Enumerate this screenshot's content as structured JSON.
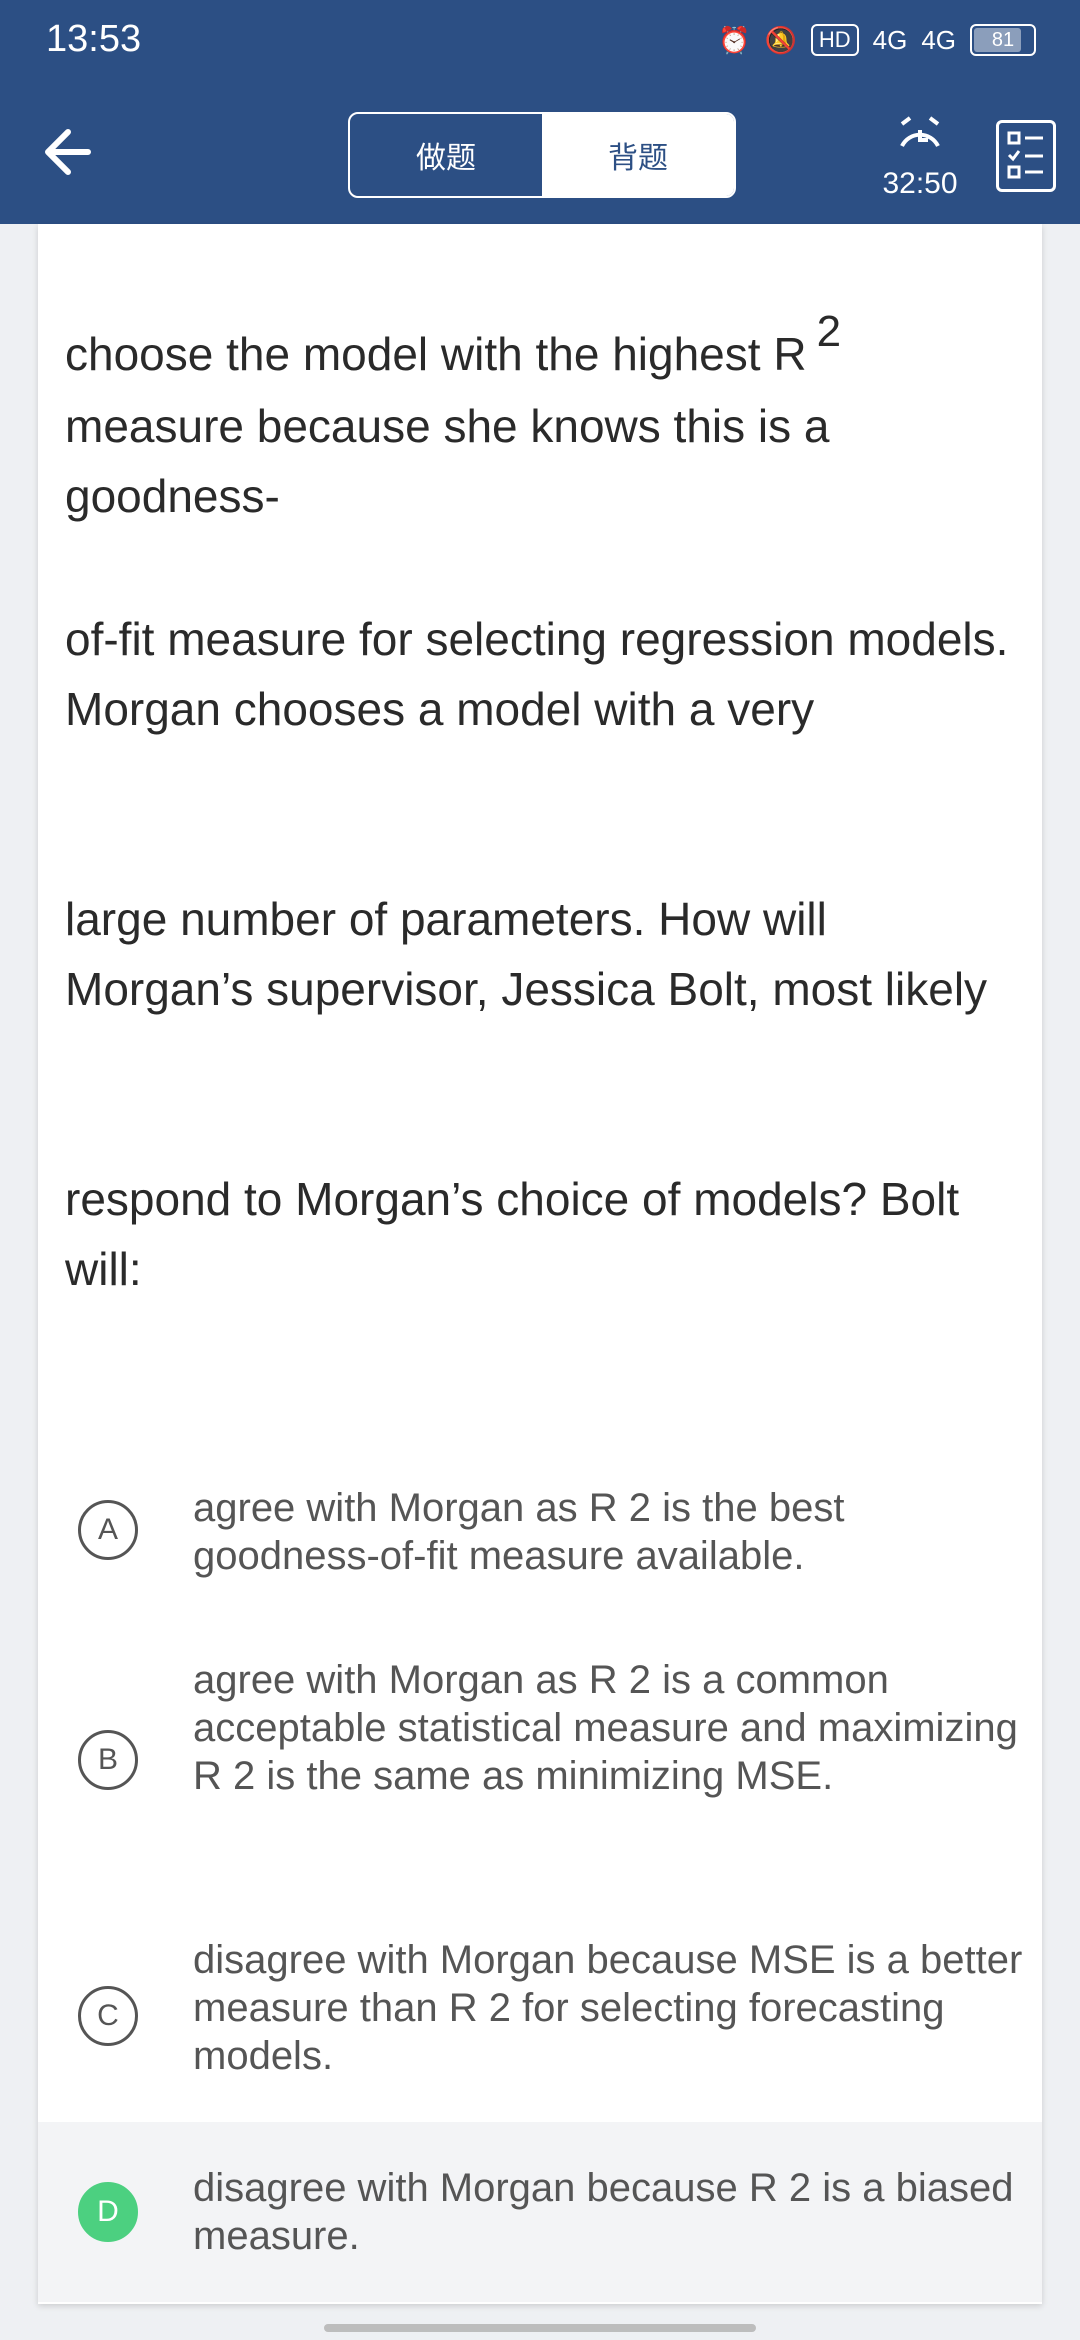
{
  "status_bar": {
    "time": "13:53",
    "icons": [
      "alarm-icon",
      "bell-off-icon",
      "hd-icon",
      "signal-4g-icon",
      "signal-4g-icon"
    ],
    "hd_label": "HD",
    "network1": "4G",
    "network2": "4G",
    "battery": "81"
  },
  "header": {
    "tab_practice": "做题",
    "tab_memorize": "背题",
    "timer": "32:50"
  },
  "question": {
    "line1_text": "choose the model with the highest R",
    "line1_sup": "2",
    "line1_rest": "measure because she knows this is a goodness-",
    "para2": "of-fit measure for selecting regression models. Morgan chooses a model with a very",
    "para3": "large number of parameters. How will Morgan’s supervisor, Jessica Bolt, most likely",
    "para4": "respond to Morgan’s choice of models? Bolt will:"
  },
  "options": [
    {
      "letter": "A",
      "text": "agree with Morgan as R 2 is the best goodness-of-fit measure available."
    },
    {
      "letter": "B",
      "text": "agree with Morgan as R 2 is a common acceptable statistical measure and maximizing R 2 is the same as minimizing MSE."
    },
    {
      "letter": "C",
      "text": "disagree with Morgan because MSE is a better measure than R 2 for selecting forecasting models."
    },
    {
      "letter": "D",
      "text": "disagree with Morgan because R 2 is a biased measure.",
      "selected": true
    }
  ],
  "colors": {
    "header_bg": "#2c4f84",
    "selected_green": "#4cd080"
  }
}
